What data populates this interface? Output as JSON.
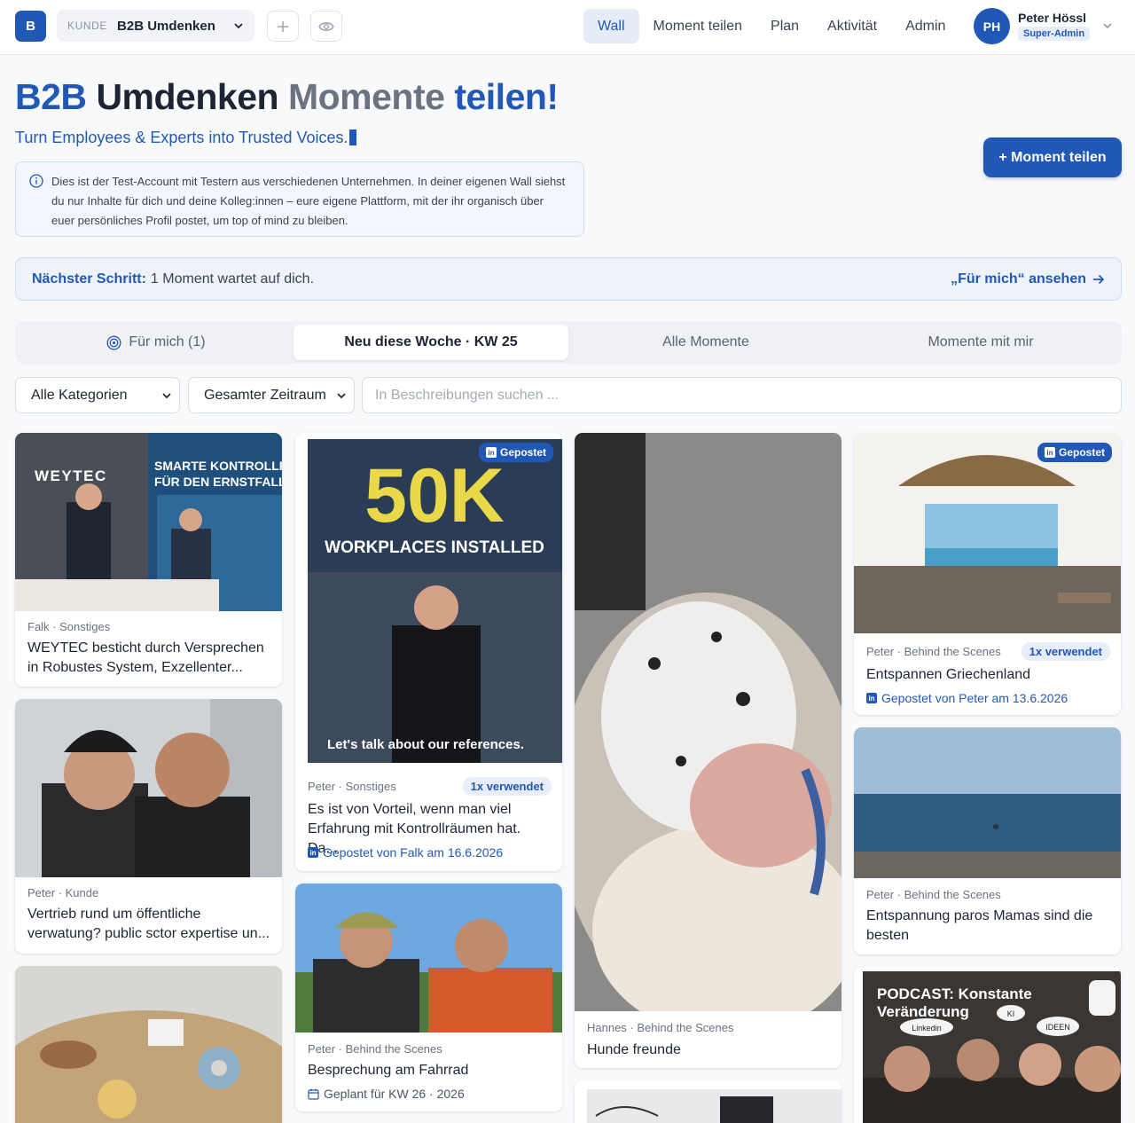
{
  "topbar": {
    "logo": "B",
    "kunde_label": "KUNDE",
    "kunde_name": "B2B Umdenken",
    "nav": [
      {
        "label": "Wall",
        "active": true
      },
      {
        "label": "Moment teilen",
        "active": false
      },
      {
        "label": "Plan",
        "active": false
      },
      {
        "label": "Aktivität",
        "active": false
      },
      {
        "label": "Admin",
        "active": false
      }
    ],
    "user": {
      "initials": "PH",
      "name": "Peter Hössl",
      "role": "Super-Admin"
    }
  },
  "header": {
    "title_brand": "B2B",
    "title_name": "Umdenken",
    "title_moments": "Momente",
    "title_share": "teilen!",
    "subtitle": "Turn Employees & Experts into Trusted Voices.",
    "cta": "+ Moment teilen",
    "info_text": "Dies ist der Test-Account mit Testern aus verschiedenen Unternehmen. In deiner eigenen Wall siehst du nur Inhalte für dich und deine Kolleg:innen – eure eigene Plattform, mit der ihr organisch über euer persönliches Profil postet, um top of mind zu bleiben."
  },
  "next_step": {
    "label": "Nächster Schritt:",
    "text": "1 Moment wartet auf dich.",
    "link": "„Für mich“ ansehen"
  },
  "tabs": [
    {
      "label": "Für mich (1)",
      "active": false
    },
    {
      "label": "Neu diese Woche · KW 25",
      "active": true
    },
    {
      "label": "Alle Momente",
      "active": false
    },
    {
      "label": "Momente mit mir",
      "active": false
    }
  ],
  "filters": {
    "category": "Alle Kategorien",
    "period": "Gesamter Zeitraum",
    "search_placeholder": "In Beschreibungen suchen ..."
  },
  "cards": {
    "c1": {
      "meta": "Falk · Sonstiges",
      "title": "WEYTEC besticht durch Versprechen in Robustes System, Exzellenter...",
      "img_text_1": "WEYTEC",
      "img_text_2": "SMARTE KONTROLLRÄ",
      "img_text_3": "FÜR DEN ERNSTFALL"
    },
    "c2": {
      "meta": "Peter · Kunde",
      "title": "Vertrieb rund um öffentliche verwatung? public sctor expertise un..."
    },
    "c4": {
      "badge": "Gepostet",
      "img_big": "50K",
      "img_sub": "WORKPLACES INSTALLED",
      "img_bottom": "Let's talk about our references.",
      "meta": "Peter · Sonstiges",
      "used": "1x verwendet",
      "title": "Es ist von Vorteil, wenn man viel Erfahrung mit Kontrollräumen hat. Da...",
      "posted": "Gepostet von Falk am 16.6.2026"
    },
    "c5": {
      "meta": "Peter · Behind the Scenes",
      "title": "Besprechung am Fahrrad",
      "planned": "Geplant für KW 26 · 2026"
    },
    "c6": {
      "meta": "Hannes · Behind the Scenes",
      "title": "Hunde freunde"
    },
    "c8": {
      "badge": "Gepostet",
      "meta": "Peter · Behind the Scenes",
      "used": "1x verwendet",
      "title": "Entspannen Griechenland",
      "posted": "Gepostet von Peter am 13.6.2026"
    },
    "c9": {
      "meta": "Peter · Behind the Scenes",
      "title": "Entspannung paros Mamas sind die besten"
    },
    "c10": {
      "img_title_1": "PODCAST: Konstante",
      "img_title_2": "Veränderung",
      "tag1": "Linkedin",
      "tag2": "KI",
      "tag3": "IDEEN"
    }
  },
  "colors": {
    "accent": "#2158b8",
    "background": "#f8f9fb"
  }
}
